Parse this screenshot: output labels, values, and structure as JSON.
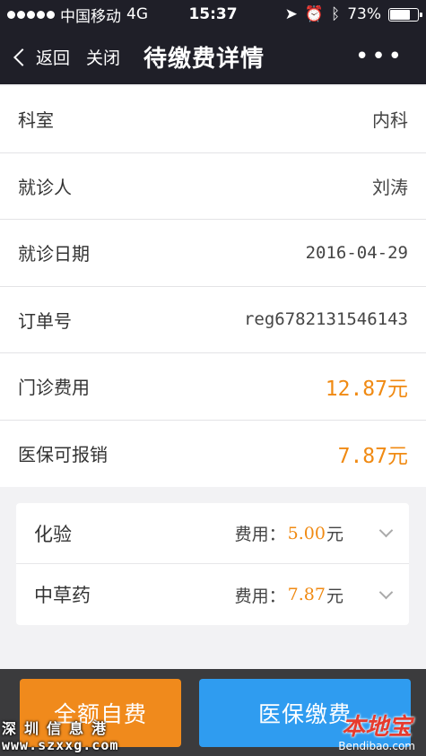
{
  "status_bar": {
    "carrier": "中国移动",
    "network": "4G",
    "time": "15:37",
    "battery_percent": "73%",
    "battery_level": 0.73
  },
  "nav": {
    "back_label": "返回",
    "close_label": "关闭",
    "title": "待缴费详情",
    "more_label": "•••"
  },
  "details": [
    {
      "label": "科室",
      "value": "内科"
    },
    {
      "label": "就诊人",
      "value": "刘涛"
    },
    {
      "label": "就诊日期",
      "value": "2016-04-29"
    },
    {
      "label": "订单号",
      "value": "reg6782131546143"
    },
    {
      "label": "门诊费用",
      "value": "12.87元"
    },
    {
      "label": "医保可报销",
      "value": "7.87元"
    }
  ],
  "fee_items": [
    {
      "name": "化验",
      "fee_label": "费用：",
      "amount": "5.00",
      "unit": "元"
    },
    {
      "name": "中草药",
      "fee_label": "费用：",
      "amount": "7.87",
      "unit": "元"
    }
  ],
  "actions": {
    "self_pay_label": "全额自费",
    "insurance_pay_label": "医保缴费"
  },
  "watermarks": {
    "left_name": "深圳信息港",
    "left_url": "www.szxxg.com",
    "right_logo": "本地宝",
    "right_domain": "Bendibao.com"
  },
  "colors": {
    "header_bg": "#1f1f28",
    "accent_orange": "#f08a13",
    "self_pay_button": "#f08a1c",
    "insurance_button": "#2f9cf0"
  }
}
